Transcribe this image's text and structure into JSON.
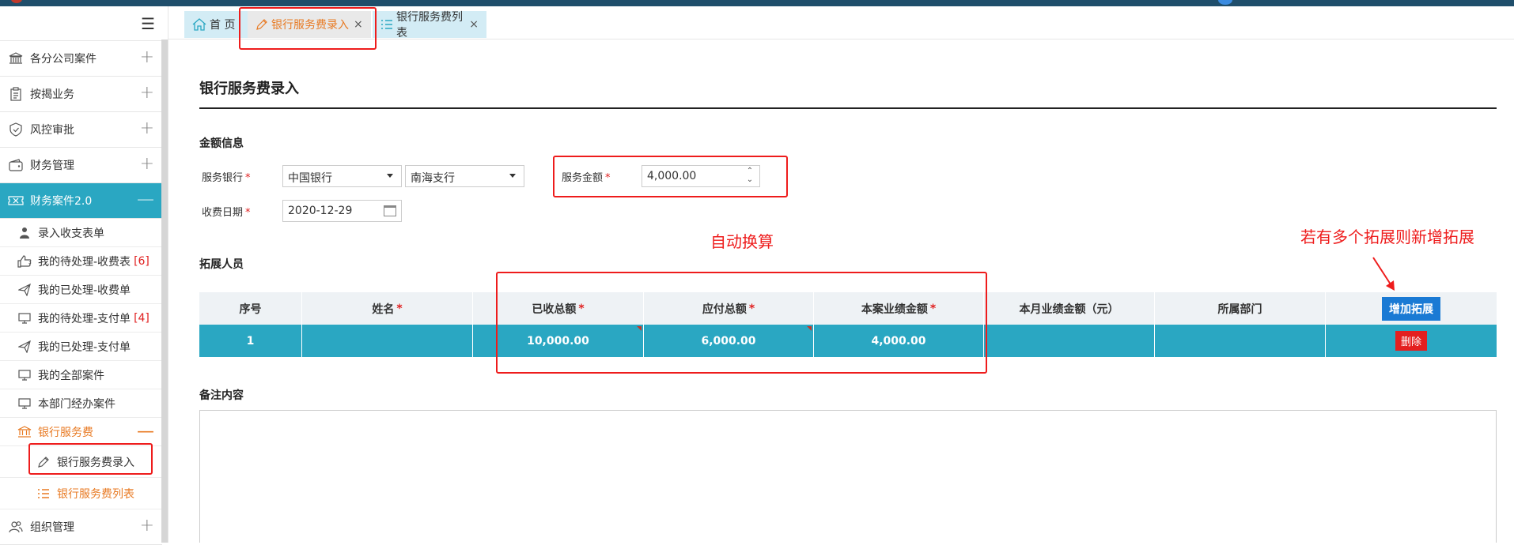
{
  "sidebar": {
    "items": [
      {
        "label": "各分公司案件"
      },
      {
        "label": "按揭业务"
      },
      {
        "label": "风控审批"
      },
      {
        "label": "财务管理"
      },
      {
        "label": "财务案件2.0"
      }
    ],
    "sub_items": [
      {
        "label": "录入收支表单"
      },
      {
        "label": "我的待处理-收费表",
        "badge": "[6]"
      },
      {
        "label": "我的已处理-收费单"
      },
      {
        "label": "我的待处理-支付单",
        "badge": "[4]"
      },
      {
        "label": "我的已处理-支付单"
      },
      {
        "label": "我的全部案件"
      },
      {
        "label": "本部门经办案件"
      },
      {
        "label": "银行服务费"
      }
    ],
    "bank_sub_items": [
      {
        "label": "银行服务费录入"
      },
      {
        "label": "银行服务费列表"
      }
    ],
    "last_item": {
      "label": "组织管理"
    }
  },
  "tabs": {
    "home": "首 页",
    "current": "银行服务费录入",
    "list": "银行服务费列表",
    "close": "×"
  },
  "page": {
    "title": "银行服务费录入",
    "amount_section": "金额信息",
    "bank_label": "服务银行",
    "bank_value": "中国银行",
    "branch_value": "南海支行",
    "amount_label": "服务金额",
    "amount_value": "4,000.00",
    "date_label": "收费日期",
    "date_value": "2020-12-29",
    "required_mark": "*",
    "expansion_section": "拓展人员",
    "remark_section": "备注内容"
  },
  "annotations": {
    "auto_convert": "自动换算",
    "add_hint": "若有多个拓展则新增拓展"
  },
  "table": {
    "headers": [
      {
        "label": "序号",
        "required": false
      },
      {
        "label": "姓名",
        "required": true
      },
      {
        "label": "已收总额",
        "required": true
      },
      {
        "label": "应付总额",
        "required": true
      },
      {
        "label": "本案业绩金额",
        "required": true
      },
      {
        "label": "本月业绩金额（元）",
        "required": false
      },
      {
        "label": "所属部门",
        "required": false
      }
    ],
    "add_button": "增加拓展",
    "delete_button": "删除",
    "rows": [
      {
        "index": "1",
        "name": "",
        "received_total": "10,000.00",
        "payable_total": "6,000.00",
        "case_performance": "4,000.00",
        "month_performance": "",
        "department": ""
      }
    ]
  },
  "colors": {
    "accent": "#2aa7c2",
    "orange": "#e87a23",
    "annotation_red": "#ee1c1c",
    "add_button": "#1a7ad4"
  }
}
